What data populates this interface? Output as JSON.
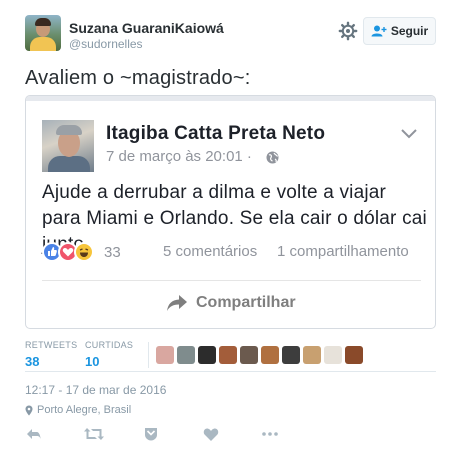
{
  "user": {
    "name": "Suzana GuaraniKaiowá",
    "handle": "@sudornelles"
  },
  "header": {
    "follow_label": "Seguir"
  },
  "tweet": {
    "text": "Avaliem o ~magistrado~:"
  },
  "embedded_post": {
    "author": "Itagiba Catta Preta Neto",
    "date": "7 de março às 20:01 · ",
    "text": "Ajude a derrubar a dilma e volte a viajar para Miami e Orlando. Se ela cair o dólar cai junto.",
    "reaction_count": "33",
    "comments": "5 comentários",
    "shares": "1 compartilhamento",
    "share_label": "Compartilhar"
  },
  "stats": {
    "retweets_label": "RETWEETS",
    "retweets_value": "38",
    "likes_label": "CURTIDAS",
    "likes_value": "10",
    "liker_colors": [
      "#d9a7a0",
      "#7f8c8d",
      "#2c2c2c",
      "#a35d3a",
      "#6b5a4e",
      "#b07040",
      "#3d3d3d",
      "#c8a070",
      "#e7e2da",
      "#8a4a2a"
    ]
  },
  "meta": {
    "timestamp": "12:17 - 17 de mar de 2016",
    "location": "Porto Alegre, Brasil"
  },
  "icons": {
    "gear": "gear-icon",
    "follow": "add-user-icon",
    "chevron": "chevron-down-icon",
    "globe": "globe-icon",
    "share": "share-arrow-icon",
    "pin": "location-pin-icon",
    "reply": "reply-icon",
    "retweet": "retweet-icon",
    "dm": "direct-message-icon",
    "like": "heart-icon",
    "more": "more-icon"
  },
  "colors": {
    "accent": "#1b95e0",
    "text": "#292f33",
    "muted": "#8899a6"
  }
}
